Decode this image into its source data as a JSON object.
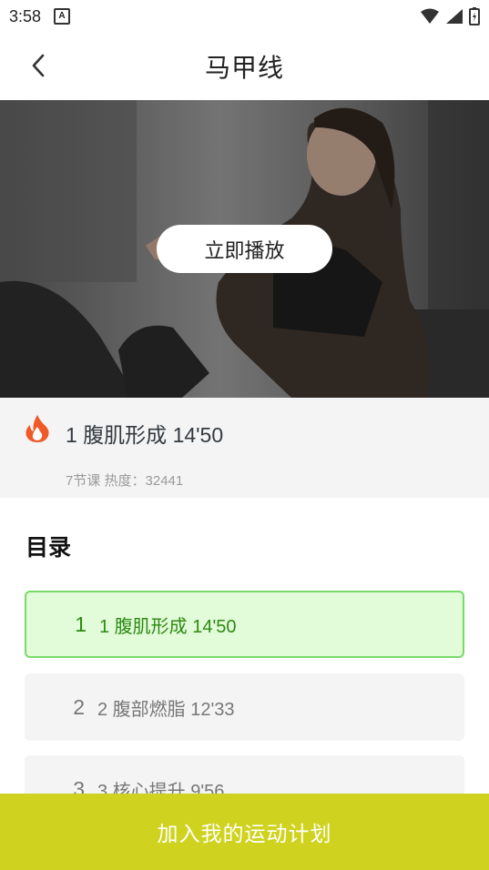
{
  "status_bar": {
    "time": "3:58",
    "notification_icon": "A"
  },
  "header": {
    "title": "马甲线"
  },
  "hero": {
    "play_label": "立即播放"
  },
  "info": {
    "title": "1 腹肌形成 14'50",
    "subtitle": "7节课 热度：32441"
  },
  "catalog": {
    "heading": "目录",
    "items": [
      {
        "num": "1",
        "name": "1 腹肌形成 14'50",
        "active": true
      },
      {
        "num": "2",
        "name": "2 腹部燃脂 12'33",
        "active": false
      },
      {
        "num": "3",
        "name": "3 核心提升 9'56",
        "active": false
      }
    ]
  },
  "bottom": {
    "cta_label": "加入我的运动计划"
  },
  "colors": {
    "accent": "#cfd31f",
    "active_bg": "#e2fbd9",
    "active_border": "#79d96a",
    "active_text": "#2d8a12",
    "flame": "#f05a28"
  }
}
